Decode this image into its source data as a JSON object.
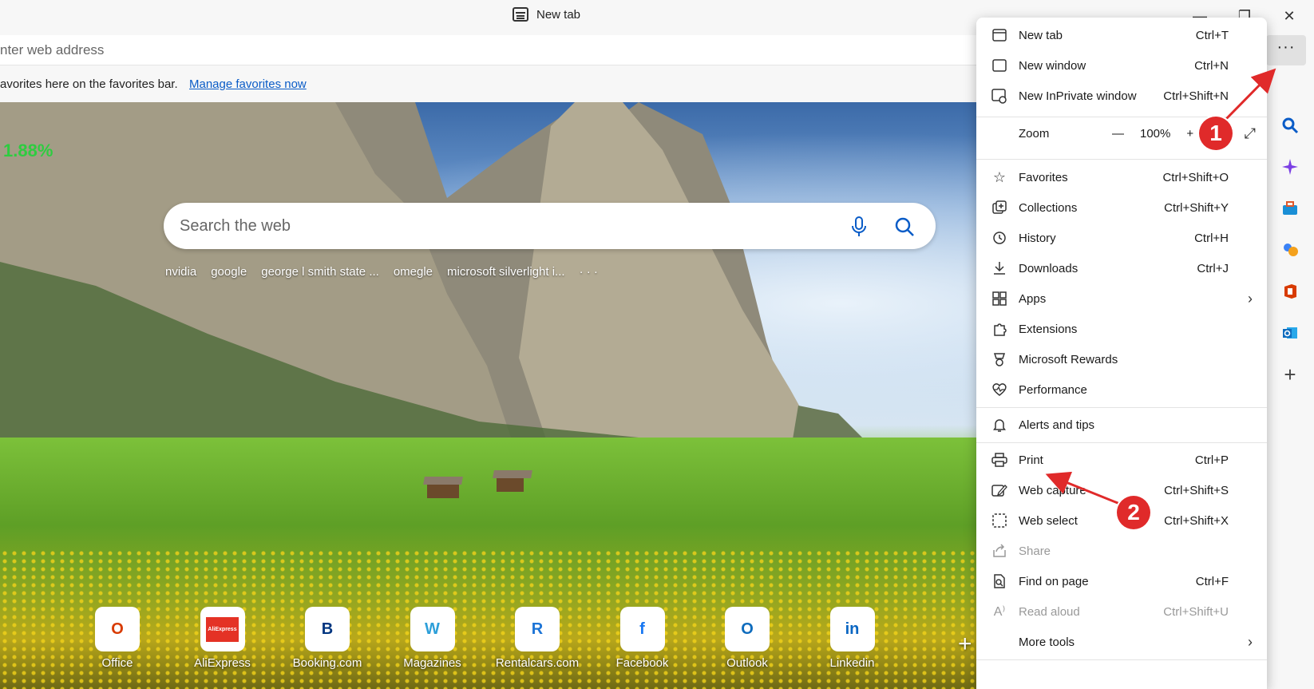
{
  "window": {
    "tab_title": "New tab"
  },
  "address_bar": {
    "placeholder": "nter web address"
  },
  "favorites_bar": {
    "text": "avorites here on the favorites bar.",
    "link": "Manage favorites now"
  },
  "stock_ticker": "1.88%",
  "search": {
    "placeholder": "Search the web",
    "suggestions": [
      "nvidia",
      "google",
      "george l smith state ...",
      "omegle",
      "microsoft silverlight i...",
      "· · ·"
    ]
  },
  "quick_links": [
    {
      "label": "Office",
      "glyph": "O",
      "color": "#d83b01",
      "icon": "office-icon"
    },
    {
      "label": "AliExpress",
      "glyph": "AliExpress",
      "color": "#e43225",
      "icon": "aliexpress-icon"
    },
    {
      "label": "Booking.com",
      "glyph": "B",
      "color": "#003580",
      "icon": "booking-icon"
    },
    {
      "label": "Magazines",
      "glyph": "W",
      "color": "#2d9fd9",
      "icon": "magazines-icon"
    },
    {
      "label": "Rentalcars.com",
      "glyph": "R",
      "color": "#1c74d6",
      "icon": "rentalcars-icon"
    },
    {
      "label": "Facebook",
      "glyph": "f",
      "color": "#1877f2",
      "icon": "facebook-icon"
    },
    {
      "label": "Outlook",
      "glyph": "O",
      "color": "#0f6cbd",
      "icon": "outlook-icon"
    },
    {
      "label": "Linkedin",
      "glyph": "in",
      "color": "#0a66c2",
      "icon": "linkedin-icon"
    }
  ],
  "menu": {
    "new_tab": {
      "label": "New tab",
      "shortcut": "Ctrl+T"
    },
    "new_window": {
      "label": "New window",
      "shortcut": "Ctrl+N"
    },
    "new_inprivate": {
      "label": "New InPrivate window",
      "shortcut": "Ctrl+Shift+N"
    },
    "zoom": {
      "label": "Zoom",
      "minus": "—",
      "value": "100%",
      "plus": "+"
    },
    "favorites": {
      "label": "Favorites",
      "shortcut": "Ctrl+Shift+O"
    },
    "collections": {
      "label": "Collections",
      "shortcut": "Ctrl+Shift+Y"
    },
    "history": {
      "label": "History",
      "shortcut": "Ctrl+H"
    },
    "downloads": {
      "label": "Downloads",
      "shortcut": "Ctrl+J"
    },
    "apps": {
      "label": "Apps"
    },
    "extensions": {
      "label": "Extensions"
    },
    "rewards": {
      "label": "Microsoft Rewards"
    },
    "performance": {
      "label": "Performance"
    },
    "alerts": {
      "label": "Alerts and tips"
    },
    "print": {
      "label": "Print",
      "shortcut": "Ctrl+P"
    },
    "web_capture": {
      "label": "Web capture",
      "shortcut": "Ctrl+Shift+S"
    },
    "web_select": {
      "label": "Web select",
      "shortcut": "Ctrl+Shift+X"
    },
    "share": {
      "label": "Share"
    },
    "find": {
      "label": "Find on page",
      "shortcut": "Ctrl+F"
    },
    "read_aloud": {
      "label": "Read aloud",
      "shortcut": "Ctrl+Shift+U"
    },
    "more_tools": {
      "label": "More tools"
    }
  },
  "annotations": {
    "badge1": "1",
    "badge2": "2"
  },
  "colors": {
    "accent": "#0a5cc7",
    "arrow": "#e02a2a"
  }
}
